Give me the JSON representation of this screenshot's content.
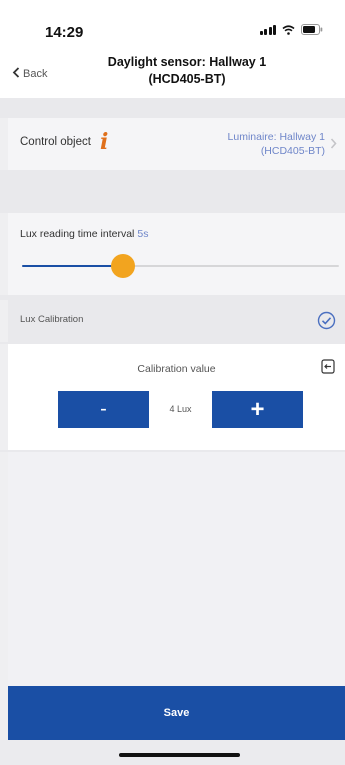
{
  "status_bar": {
    "time": "14:29"
  },
  "header": {
    "back_label": "Back",
    "title_line1": "Daylight sensor: Hallway 1",
    "title_line2": "(HCD405-BT)"
  },
  "control_object": {
    "label": "Control object",
    "value_line1": "Luminaire: Hallway 1",
    "value_line2": "(HCD405-BT)"
  },
  "lux_interval": {
    "label": "Lux reading time interval",
    "unit": "5s",
    "slider_fraction": 0.32
  },
  "lux_calibration": {
    "label": "Lux Calibration",
    "checked": true
  },
  "calibration": {
    "title": "Calibration value",
    "minus_label": "-",
    "value": "4 Lux",
    "plus_label": "+"
  },
  "footer": {
    "save_label": "Save"
  },
  "colors": {
    "accent_blue": "#1a4fa5",
    "slider_thumb": "#f2a41f",
    "info_icon": "#e0701b",
    "link_text": "#6f86c9"
  },
  "icons": {
    "back": "chevron-left-icon",
    "info": "info-icon",
    "chevron": "chevron-right-icon",
    "check": "check-circle-icon",
    "reset": "reset-icon"
  }
}
